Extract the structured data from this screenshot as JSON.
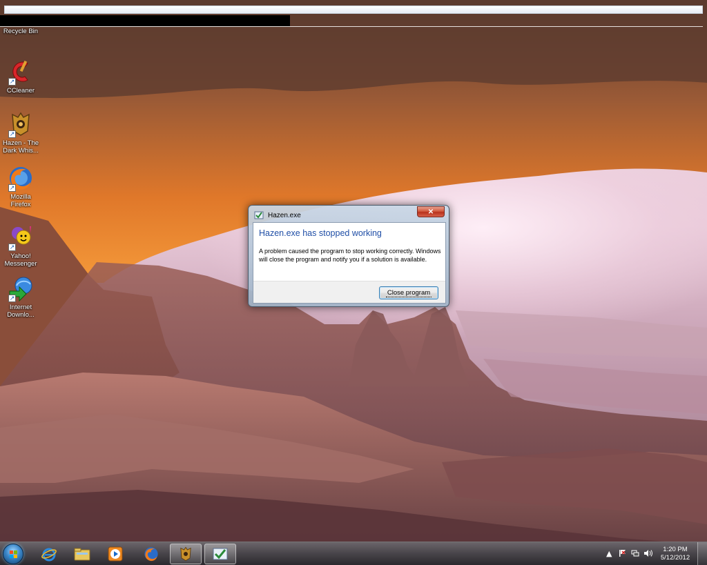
{
  "desktop": {
    "icons": [
      {
        "name": "recycle-bin",
        "label": "Recycle Bin"
      },
      {
        "name": "ccleaner",
        "label": "CCleaner"
      },
      {
        "name": "hazen",
        "label": "Hazen - The Dark Whis..."
      },
      {
        "name": "firefox",
        "label": "Mozilla Firefox"
      },
      {
        "name": "yahoo",
        "label": "Yahoo! Messenger"
      },
      {
        "name": "idm",
        "label": "Internet Downlo..."
      }
    ]
  },
  "dialog": {
    "window_title": "Hazen.exe",
    "close_glyph": "✕",
    "heading": "Hazen.exe has stopped working",
    "message": "A problem caused the program to stop working correctly. Windows will close the program and notify you if a solution is available.",
    "button_label": "Close program"
  },
  "taskbar": {
    "pinned": [
      "internet-explorer-icon",
      "explorer-icon",
      "media-player-icon",
      "firefox-icon",
      "hazen-icon",
      "hazen-error-icon"
    ],
    "tray": {
      "chevron": "▲",
      "time": "1:20 PM",
      "date": "5/12/2012"
    }
  },
  "colors": {
    "heading_blue": "#1f4ea6",
    "close_red": "#c8412a"
  }
}
